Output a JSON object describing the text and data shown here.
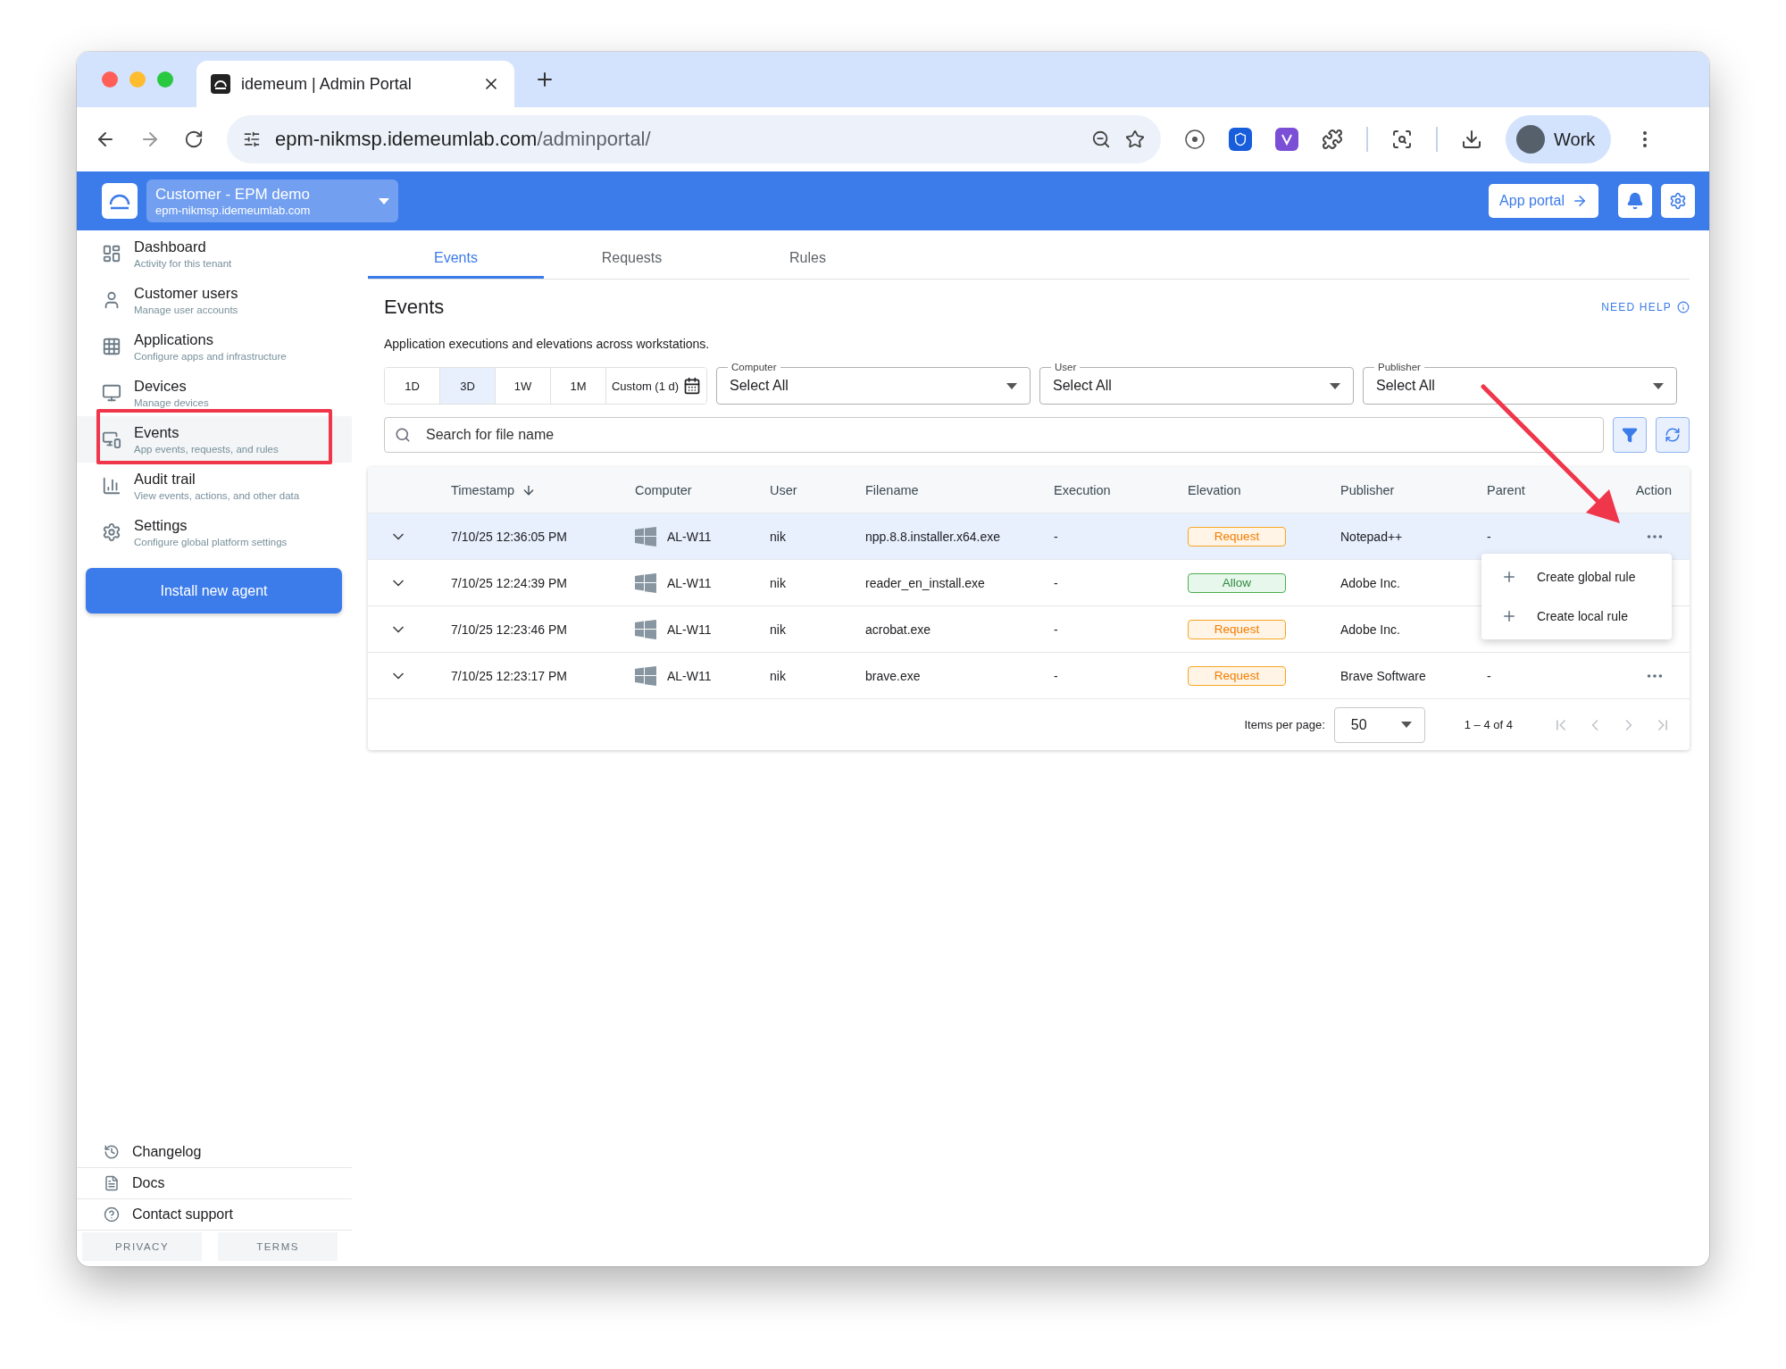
{
  "browser": {
    "tab_title": "idemeum | Admin Portal",
    "url_host": "epm-nikmsp.idemeumlab.com",
    "url_path": "/adminportal/",
    "profile": "Work"
  },
  "header": {
    "tenant_name": "Customer - EPM demo",
    "tenant_domain": "epm-nikmsp.idemeumlab.com",
    "app_portal": "App portal"
  },
  "sidebar": {
    "items": [
      {
        "title": "Dashboard",
        "subtitle": "Activity for this tenant",
        "selected": false
      },
      {
        "title": "Customer users",
        "subtitle": "Manage user accounts",
        "selected": false
      },
      {
        "title": "Applications",
        "subtitle": "Configure apps and infrastructure",
        "selected": false
      },
      {
        "title": "Devices",
        "subtitle": "Manage devices",
        "selected": false
      },
      {
        "title": "Events",
        "subtitle": "App events, requests, and rules",
        "selected": true
      },
      {
        "title": "Audit trail",
        "subtitle": "View events, actions, and other data",
        "selected": false
      },
      {
        "title": "Settings",
        "subtitle": "Configure global platform settings",
        "selected": false
      }
    ],
    "install_button": "Install new agent",
    "footer_links": [
      "Changelog",
      "Docs",
      "Contact support"
    ],
    "legal": [
      "PRIVACY",
      "TERMS"
    ]
  },
  "tabs": [
    {
      "label": "Events",
      "selected": true
    },
    {
      "label": "Requests",
      "selected": false
    },
    {
      "label": "Rules",
      "selected": false
    }
  ],
  "page": {
    "title": "Events",
    "help": "NEED HELP",
    "description": "Application executions and elevations across workstations."
  },
  "filters": {
    "ranges": [
      {
        "label": "1D",
        "selected": false
      },
      {
        "label": "3D",
        "selected": true
      },
      {
        "label": "1W",
        "selected": false
      },
      {
        "label": "1M",
        "selected": false
      },
      {
        "label": "Custom (1 d)",
        "selected": false
      }
    ],
    "dropdowns": [
      {
        "label": "Computer",
        "value": "Select All"
      },
      {
        "label": "User",
        "value": "Select All"
      },
      {
        "label": "Publisher",
        "value": "Select All"
      }
    ],
    "search": {
      "placeholder": "Search for file name"
    }
  },
  "table": {
    "columns": [
      {
        "label": "Timestamp",
        "sorted": true
      },
      {
        "label": "Computer",
        "sorted": false
      },
      {
        "label": "User",
        "sorted": false
      },
      {
        "label": "Filename",
        "sorted": false
      },
      {
        "label": "Execution",
        "sorted": false
      },
      {
        "label": "Elevation",
        "sorted": false
      },
      {
        "label": "Publisher",
        "sorted": false
      },
      {
        "label": "Parent",
        "sorted": false
      },
      {
        "label": "Action",
        "sorted": false
      }
    ],
    "rows": [
      {
        "timestamp": "7/10/25 12:36:05 PM",
        "computer": "AL-W11",
        "user": "nik",
        "filename": "npp.8.8.installer.x64.exe",
        "execution": "-",
        "elevation": {
          "label": "Request",
          "kind": "request"
        },
        "publisher": "Notepad++",
        "parent": "-",
        "show_action": true,
        "selected": true
      },
      {
        "timestamp": "7/10/25 12:24:39 PM",
        "computer": "AL-W11",
        "user": "nik",
        "filename": "reader_en_install.exe",
        "execution": "-",
        "elevation": {
          "label": "Allow",
          "kind": "allow"
        },
        "publisher": "Adobe Inc.",
        "selected": false
      },
      {
        "timestamp": "7/10/25 12:23:46 PM",
        "computer": "AL-W11",
        "user": "nik",
        "filename": "acrobat.exe",
        "execution": "-",
        "elevation": {
          "label": "Request",
          "kind": "request"
        },
        "publisher": "Adobe Inc.",
        "selected": false
      },
      {
        "timestamp": "7/10/25 12:23:17 PM",
        "computer": "AL-W11",
        "user": "nik",
        "filename": "brave.exe",
        "execution": "-",
        "elevation": {
          "label": "Request",
          "kind": "request"
        },
        "publisher": "Brave Software",
        "parent": "-",
        "show_action": true,
        "selected": false
      }
    ],
    "menu": [
      "Create global rule",
      "Create local rule"
    ],
    "pagination": {
      "label": "Items per page:",
      "per_page": "50",
      "range": "1 – 4 of 4"
    }
  },
  "annotations": {
    "highlight_box": true,
    "pointer_arrow": true
  }
}
